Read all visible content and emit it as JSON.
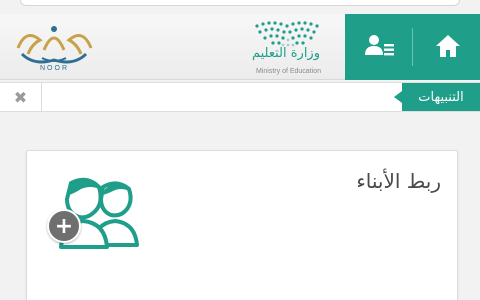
{
  "header": {
    "ministry_name_ar": "وزارة التعليم",
    "ministry_name_en": "Ministry of Education",
    "noor_label": "NOOR",
    "nav": [
      {
        "icon": "home-icon"
      },
      {
        "icon": "users-list-icon"
      }
    ]
  },
  "alerts": {
    "label": "التنبيهات",
    "close_symbol": "✖"
  },
  "card": {
    "title": "ربط الأبناء",
    "icon": "children-add-icon",
    "badge_symbol": "+"
  },
  "colors": {
    "accent": "#1f9e8a",
    "badge": "#6f6f6f",
    "noor_gold": "#c8a24a",
    "noor_blue": "#2f6f94"
  }
}
